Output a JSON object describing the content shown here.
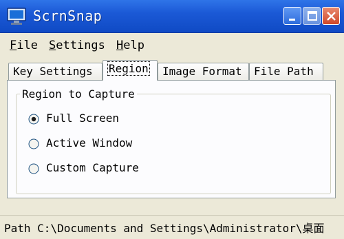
{
  "window": {
    "title": "ScrnSnap",
    "icon": "monitor-icon"
  },
  "menu": [
    {
      "mnemonic": "F",
      "rest": "ile"
    },
    {
      "mnemonic": "S",
      "rest": "ettings"
    },
    {
      "mnemonic": "H",
      "rest": "elp"
    }
  ],
  "tabs": [
    {
      "label": "Key Settings",
      "active": false
    },
    {
      "label": "Region",
      "active": true
    },
    {
      "label": "Image Format",
      "active": false
    },
    {
      "label": "File Path",
      "active": false
    }
  ],
  "region": {
    "group_label": "Region to Capture",
    "options": [
      {
        "label": "Full Screen",
        "selected": true
      },
      {
        "label": "Active Window",
        "selected": false
      },
      {
        "label": "Custom Capture",
        "selected": false
      }
    ]
  },
  "status": {
    "text": "Path C:\\Documents and Settings\\Administrator\\桌面"
  },
  "colors": {
    "titlebar": "#1b59d6",
    "face": "#ece9d8",
    "panel": "#fcfcfe"
  }
}
